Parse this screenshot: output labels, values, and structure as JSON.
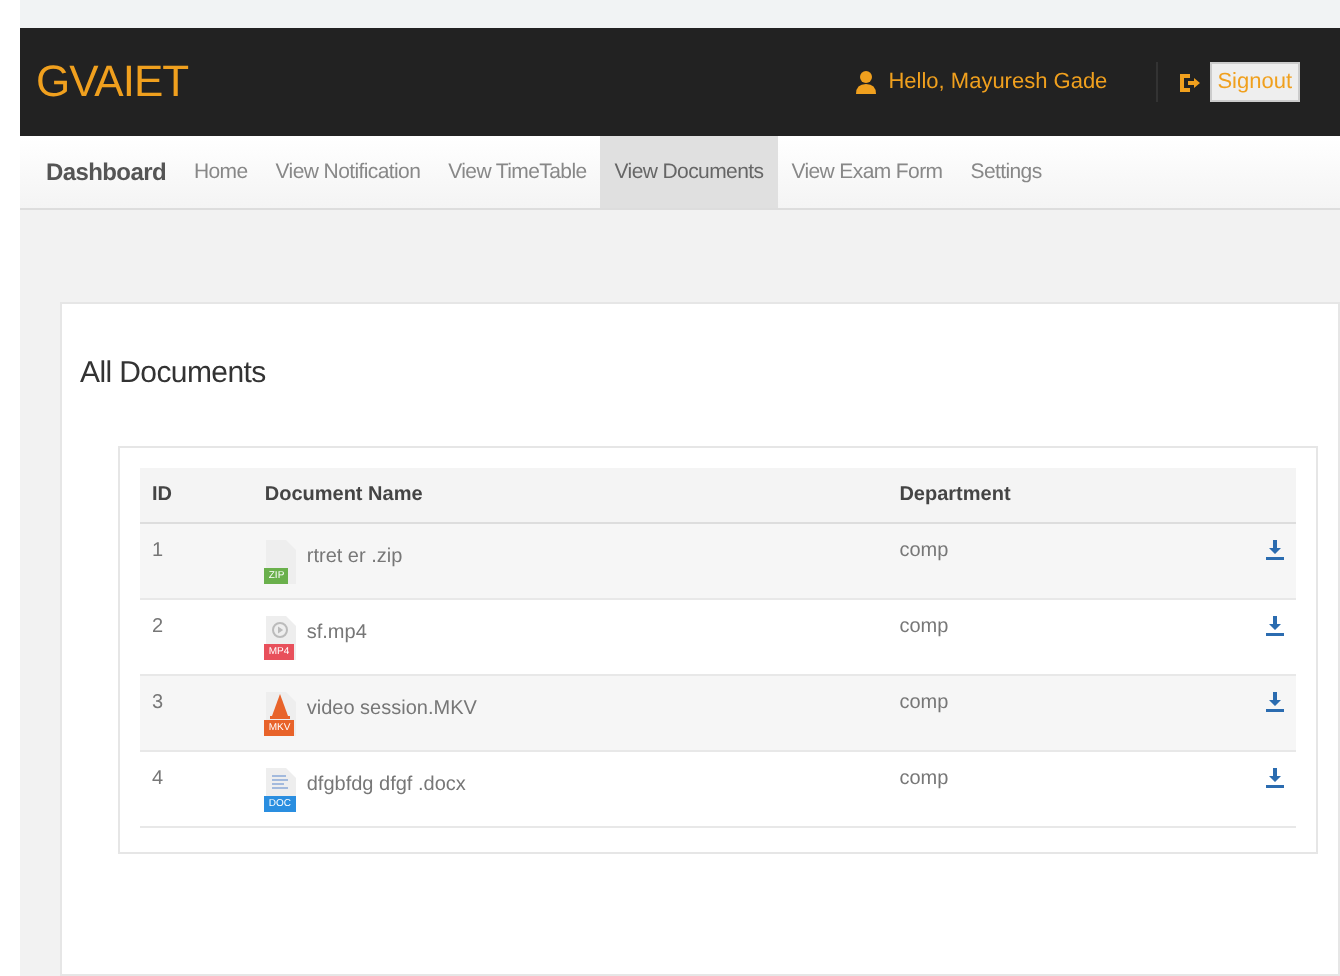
{
  "header": {
    "brand": "GVAIET",
    "greeting": "Hello,  Mayuresh Gade",
    "signout": "Signout"
  },
  "nav": [
    {
      "label": "Dashboard",
      "kind": "brand",
      "selected": false
    },
    {
      "label": "Home",
      "kind": "link",
      "selected": false
    },
    {
      "label": "View Notification",
      "kind": "link",
      "selected": false
    },
    {
      "label": "View TimeTable",
      "kind": "link",
      "selected": false
    },
    {
      "label": "View Documents",
      "kind": "link",
      "selected": true
    },
    {
      "label": "View Exam Form",
      "kind": "link",
      "selected": false
    },
    {
      "label": "Settings",
      "kind": "link",
      "selected": false
    }
  ],
  "page_title": "All Documents",
  "table": {
    "columns": [
      "ID",
      "Document Name",
      "Department"
    ],
    "rows": [
      {
        "id": "1",
        "name": "rtret er .zip",
        "kind": "zip",
        "badge": "ZIP",
        "department": "comp"
      },
      {
        "id": "2",
        "name": "sf.mp4",
        "kind": "mp4",
        "badge": "MP4",
        "department": "comp"
      },
      {
        "id": "3",
        "name": "video session.MKV",
        "kind": "mkv",
        "badge": "MKV",
        "department": "comp"
      },
      {
        "id": "4",
        "name": "dfgbfdg dfgf .docx",
        "kind": "doc",
        "badge": "DOC",
        "department": "comp"
      }
    ]
  }
}
